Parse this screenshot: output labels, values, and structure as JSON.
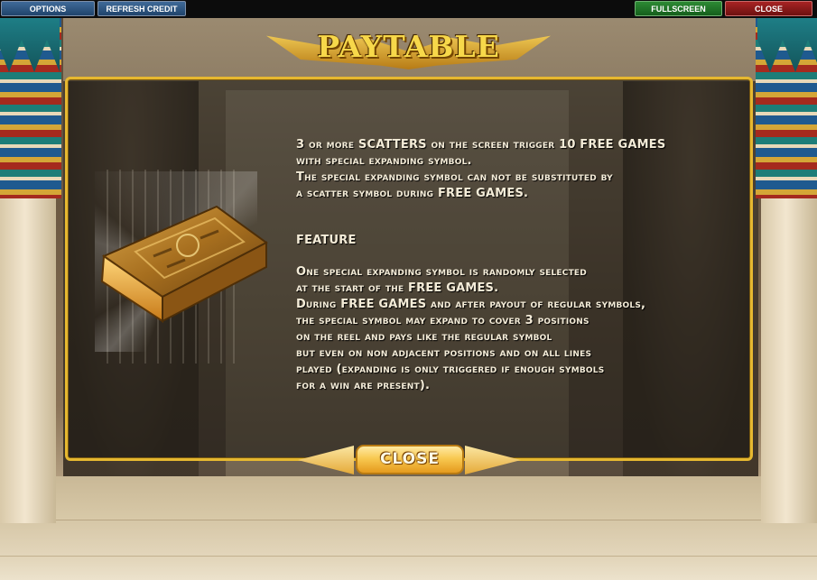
{
  "topbar": {
    "options_label": "OPTIONS",
    "refresh_label": "REFRESH CREDIT",
    "fullscreen_label": "FULLSCREEN",
    "close_label": "CLOSE"
  },
  "paytable": {
    "title": "PAYTABLE",
    "scatter_text": "3 or more SCATTERS on the screen trigger 10 FREE GAMES\nwith special expanding symbol.\nThe special expanding symbol can not be substituted by\na scatter symbol during FREE GAMES.",
    "feature_heading": "FEATURE",
    "feature_text": "One special expanding symbol is randomly selected\nat the start of the FREE GAMES.\nDuring FREE GAMES and after payout of regular symbols,\nthe special symbol may expand to cover 3 positions\non the reel and pays like the regular symbol\nbut even on non adjacent positions and on all lines\nplayed (expanding is only triggered if enough symbols\nfor a win are present).",
    "close_button_label": "CLOSE",
    "symbol_icon": "book-of-ra-icon"
  },
  "colors": {
    "gold_border": "#e6b830",
    "text": "#f4ecd8",
    "button_blue": "#2d5580",
    "button_green": "#1f7a27",
    "button_red": "#8c1818"
  }
}
